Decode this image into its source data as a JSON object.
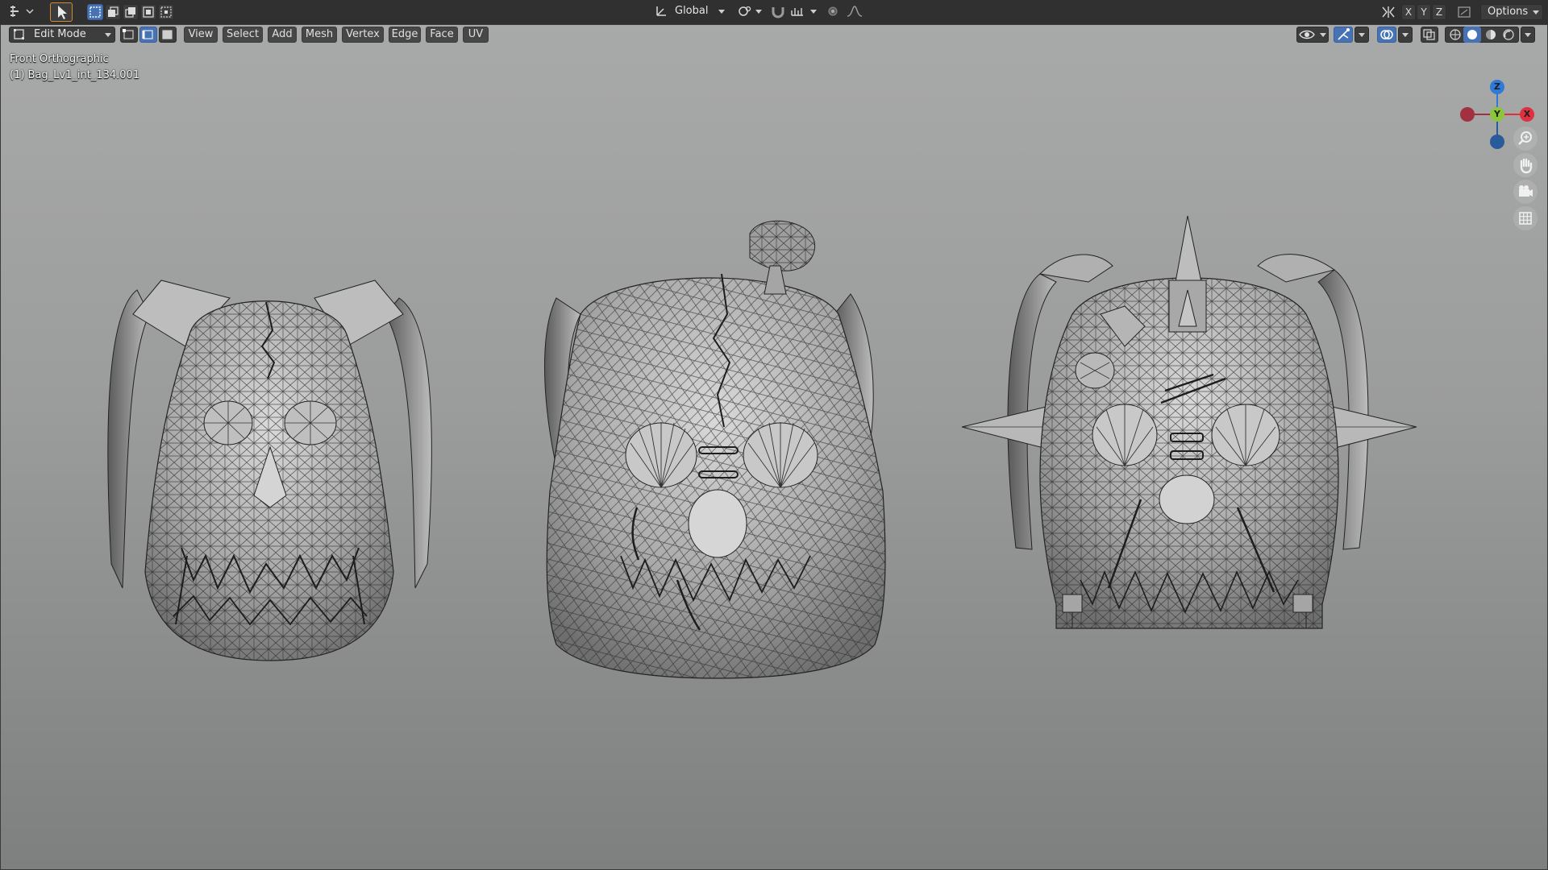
{
  "header": {
    "transform_orientation": "Global",
    "axis_x": "X",
    "axis_y": "Y",
    "axis_z": "Z",
    "options_label": "Options"
  },
  "viewport_header": {
    "mode": "Edit Mode",
    "menus": [
      "View",
      "Select",
      "Add",
      "Mesh",
      "Vertex",
      "Edge",
      "Face",
      "UV"
    ]
  },
  "overlay": {
    "view_name": "Front Orthographic",
    "object_name": "(1) Bag_Lv1_int_134.001"
  },
  "gizmo": {
    "z_label": "Z",
    "y_label": "Y",
    "x_label": "X",
    "colors": {
      "x": "#e0303f",
      "y": "#8cc43a",
      "z": "#2f7ad9"
    }
  },
  "nav_icons": [
    "zoom-icon",
    "hand-pan-icon",
    "camera-icon",
    "grid-ortho-icon"
  ],
  "models": [
    {
      "name": "skull-backpack-left"
    },
    {
      "name": "skull-backpack-center"
    },
    {
      "name": "skull-backpack-right"
    }
  ]
}
